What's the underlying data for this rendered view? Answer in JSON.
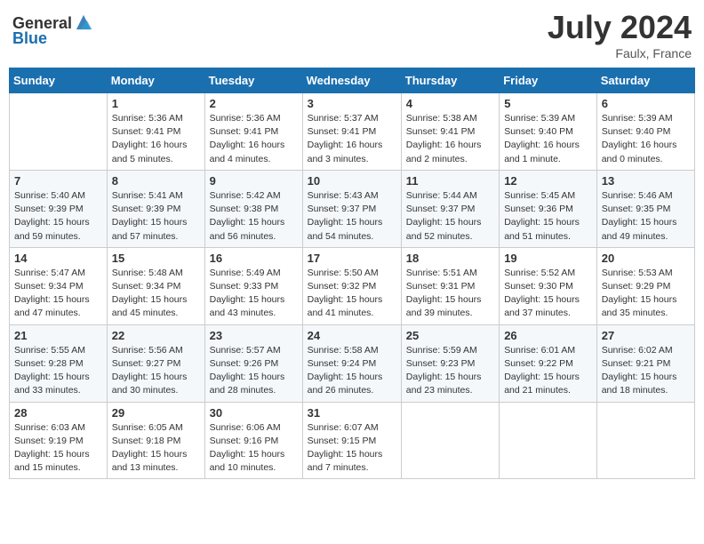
{
  "header": {
    "logo_general": "General",
    "logo_blue": "Blue",
    "month_year": "July 2024",
    "location": "Faulx, France"
  },
  "days_of_week": [
    "Sunday",
    "Monday",
    "Tuesday",
    "Wednesday",
    "Thursday",
    "Friday",
    "Saturday"
  ],
  "weeks": [
    [
      {
        "day": "",
        "info": ""
      },
      {
        "day": "1",
        "info": "Sunrise: 5:36 AM\nSunset: 9:41 PM\nDaylight: 16 hours\nand 5 minutes."
      },
      {
        "day": "2",
        "info": "Sunrise: 5:36 AM\nSunset: 9:41 PM\nDaylight: 16 hours\nand 4 minutes."
      },
      {
        "day": "3",
        "info": "Sunrise: 5:37 AM\nSunset: 9:41 PM\nDaylight: 16 hours\nand 3 minutes."
      },
      {
        "day": "4",
        "info": "Sunrise: 5:38 AM\nSunset: 9:41 PM\nDaylight: 16 hours\nand 2 minutes."
      },
      {
        "day": "5",
        "info": "Sunrise: 5:39 AM\nSunset: 9:40 PM\nDaylight: 16 hours\nand 1 minute."
      },
      {
        "day": "6",
        "info": "Sunrise: 5:39 AM\nSunset: 9:40 PM\nDaylight: 16 hours\nand 0 minutes."
      }
    ],
    [
      {
        "day": "7",
        "info": "Sunrise: 5:40 AM\nSunset: 9:39 PM\nDaylight: 15 hours\nand 59 minutes."
      },
      {
        "day": "8",
        "info": "Sunrise: 5:41 AM\nSunset: 9:39 PM\nDaylight: 15 hours\nand 57 minutes."
      },
      {
        "day": "9",
        "info": "Sunrise: 5:42 AM\nSunset: 9:38 PM\nDaylight: 15 hours\nand 56 minutes."
      },
      {
        "day": "10",
        "info": "Sunrise: 5:43 AM\nSunset: 9:37 PM\nDaylight: 15 hours\nand 54 minutes."
      },
      {
        "day": "11",
        "info": "Sunrise: 5:44 AM\nSunset: 9:37 PM\nDaylight: 15 hours\nand 52 minutes."
      },
      {
        "day": "12",
        "info": "Sunrise: 5:45 AM\nSunset: 9:36 PM\nDaylight: 15 hours\nand 51 minutes."
      },
      {
        "day": "13",
        "info": "Sunrise: 5:46 AM\nSunset: 9:35 PM\nDaylight: 15 hours\nand 49 minutes."
      }
    ],
    [
      {
        "day": "14",
        "info": "Sunrise: 5:47 AM\nSunset: 9:34 PM\nDaylight: 15 hours\nand 47 minutes."
      },
      {
        "day": "15",
        "info": "Sunrise: 5:48 AM\nSunset: 9:34 PM\nDaylight: 15 hours\nand 45 minutes."
      },
      {
        "day": "16",
        "info": "Sunrise: 5:49 AM\nSunset: 9:33 PM\nDaylight: 15 hours\nand 43 minutes."
      },
      {
        "day": "17",
        "info": "Sunrise: 5:50 AM\nSunset: 9:32 PM\nDaylight: 15 hours\nand 41 minutes."
      },
      {
        "day": "18",
        "info": "Sunrise: 5:51 AM\nSunset: 9:31 PM\nDaylight: 15 hours\nand 39 minutes."
      },
      {
        "day": "19",
        "info": "Sunrise: 5:52 AM\nSunset: 9:30 PM\nDaylight: 15 hours\nand 37 minutes."
      },
      {
        "day": "20",
        "info": "Sunrise: 5:53 AM\nSunset: 9:29 PM\nDaylight: 15 hours\nand 35 minutes."
      }
    ],
    [
      {
        "day": "21",
        "info": "Sunrise: 5:55 AM\nSunset: 9:28 PM\nDaylight: 15 hours\nand 33 minutes."
      },
      {
        "day": "22",
        "info": "Sunrise: 5:56 AM\nSunset: 9:27 PM\nDaylight: 15 hours\nand 30 minutes."
      },
      {
        "day": "23",
        "info": "Sunrise: 5:57 AM\nSunset: 9:26 PM\nDaylight: 15 hours\nand 28 minutes."
      },
      {
        "day": "24",
        "info": "Sunrise: 5:58 AM\nSunset: 9:24 PM\nDaylight: 15 hours\nand 26 minutes."
      },
      {
        "day": "25",
        "info": "Sunrise: 5:59 AM\nSunset: 9:23 PM\nDaylight: 15 hours\nand 23 minutes."
      },
      {
        "day": "26",
        "info": "Sunrise: 6:01 AM\nSunset: 9:22 PM\nDaylight: 15 hours\nand 21 minutes."
      },
      {
        "day": "27",
        "info": "Sunrise: 6:02 AM\nSunset: 9:21 PM\nDaylight: 15 hours\nand 18 minutes."
      }
    ],
    [
      {
        "day": "28",
        "info": "Sunrise: 6:03 AM\nSunset: 9:19 PM\nDaylight: 15 hours\nand 15 minutes."
      },
      {
        "day": "29",
        "info": "Sunrise: 6:05 AM\nSunset: 9:18 PM\nDaylight: 15 hours\nand 13 minutes."
      },
      {
        "day": "30",
        "info": "Sunrise: 6:06 AM\nSunset: 9:16 PM\nDaylight: 15 hours\nand 10 minutes."
      },
      {
        "day": "31",
        "info": "Sunrise: 6:07 AM\nSunset: 9:15 PM\nDaylight: 15 hours\nand 7 minutes."
      },
      {
        "day": "",
        "info": ""
      },
      {
        "day": "",
        "info": ""
      },
      {
        "day": "",
        "info": ""
      }
    ]
  ]
}
